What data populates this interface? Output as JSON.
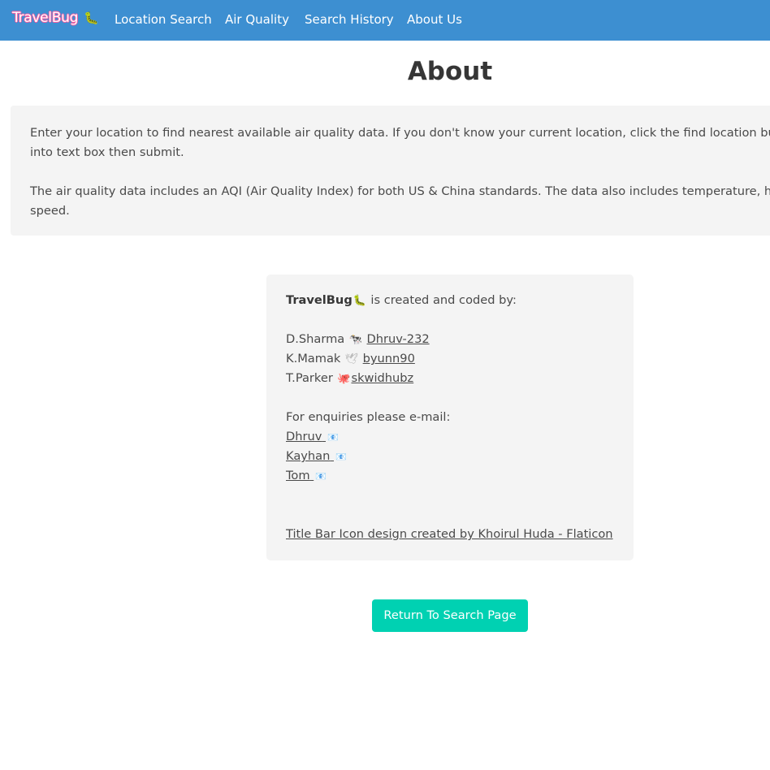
{
  "nav": {
    "brand": "TravelBug",
    "brand_icon": "caterpillar-icon",
    "links": [
      "Location Search",
      "Air Quality",
      "Search History",
      "About Us"
    ],
    "background": "#3d8fd1"
  },
  "page": {
    "title": "About"
  },
  "intro": {
    "paragraph1_line1": "Enter your location to find nearest available air quality data. If you don't know your current location, click the find location button,",
    "paragraph1_line2": "into text box then submit.",
    "paragraph2_line1": "The air quality data includes an AQI (Air Quality Index) for both US & China standards. The data also includes temperature, humid",
    "paragraph2_line2": "speed."
  },
  "credits": {
    "product": "TravelBug",
    "created_by": "is created and coded by:",
    "authors": [
      {
        "name": "D.Sharma",
        "icon": "cow-icon",
        "handle": "Dhruv-232"
      },
      {
        "name": "K.Mamak",
        "icon": "bird-icon",
        "handle": "byunn90"
      },
      {
        "name": "T.Parker",
        "icon": "octopus-icon",
        "handle": "skwidhubz"
      }
    ],
    "enquiries_label": "For enquiries please e-mail:",
    "emails": [
      {
        "label": "Dhruv",
        "icon": "envelope-icon"
      },
      {
        "label": "Kayhan",
        "icon": "envelope-icon"
      },
      {
        "label": "Tom",
        "icon": "envelope-icon"
      }
    ],
    "attribution": "Title Bar Icon design created by Khoirul Huda - Flaticon"
  },
  "actions": {
    "return_label": "Return To Search Page",
    "return_color": "#00d1b2"
  }
}
